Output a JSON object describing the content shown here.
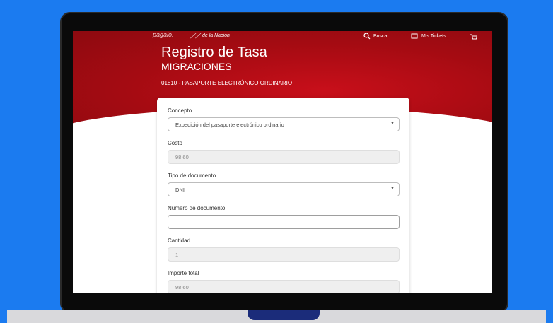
{
  "header": {
    "logo_left": "pagalo.",
    "logo_right": "de la Nación",
    "search_label": "Buscar",
    "tickets_label": "Mis Tickets"
  },
  "page": {
    "title": "Registro de Tasa",
    "subtitle": "MIGRACIONES",
    "code": "01810 - PASAPORTE ELECTRÓNICO ORDINARIO"
  },
  "form": {
    "concepto": {
      "label": "Concepto",
      "value": "Expedición del pasaporte electrónico ordinario"
    },
    "costo": {
      "label": "Costo",
      "value": "98.60"
    },
    "tipo_documento": {
      "label": "Tipo de documento",
      "value": "DNI"
    },
    "numero_documento": {
      "label": "Número de documento",
      "value": ""
    },
    "cantidad": {
      "label": "Cantidad",
      "value": "1"
    },
    "importe_total": {
      "label": "Importe total",
      "value": "98.60"
    }
  },
  "colors": {
    "background": "#1b7bf0",
    "brand_red": "#b70c15",
    "laptop_accent": "#1b2c7a"
  }
}
